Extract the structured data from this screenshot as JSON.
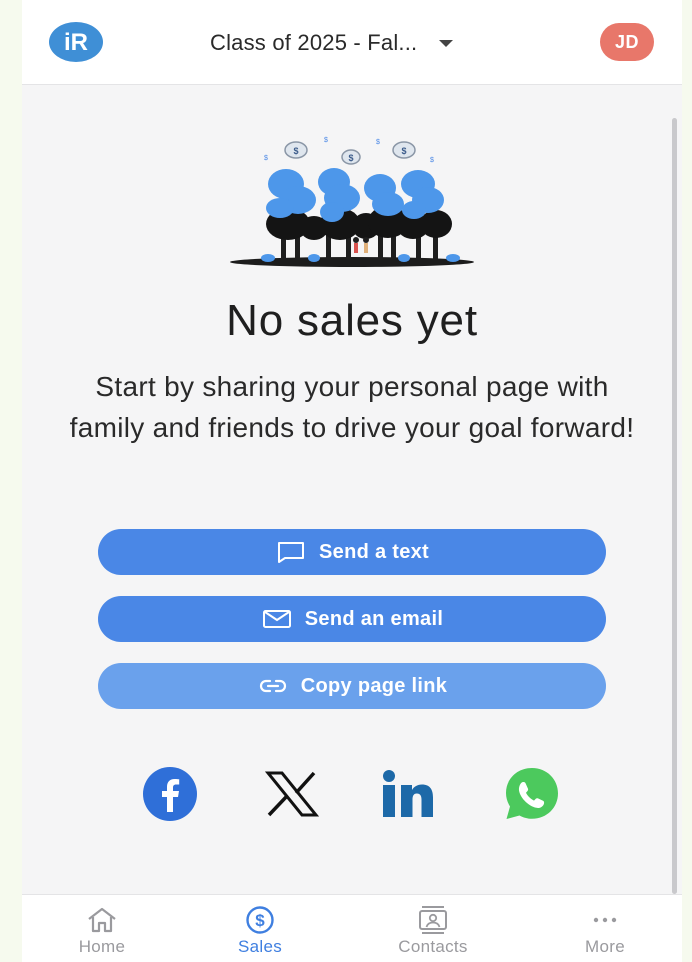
{
  "header": {
    "org_name": "Class of 2025 - Fal...",
    "avatar_initials": "JD",
    "logo_text": "iR"
  },
  "empty_state": {
    "title": "No sales yet",
    "message": "Start by sharing your personal page with family and friends to drive your goal forward!",
    "coin_symbol": "$"
  },
  "actions": {
    "send_text": "Send a text",
    "send_email": "Send an email",
    "copy_link": "Copy page link"
  },
  "social": [
    {
      "name": "facebook-icon"
    },
    {
      "name": "x-icon"
    },
    {
      "name": "linkedin-icon"
    },
    {
      "name": "whatsapp-icon"
    }
  ],
  "nav": {
    "home": "Home",
    "sales": "Sales",
    "contacts": "Contacts",
    "more": "More",
    "active": "sales"
  },
  "colors": {
    "primary": "#4a87e6",
    "primary_light": "#6aa1ec",
    "avatar": "#e8776a",
    "active_nav": "#3f7fe0",
    "facebook": "#2f6fd8",
    "linkedin": "#1d69a8",
    "whatsapp": "#4cc95d"
  }
}
